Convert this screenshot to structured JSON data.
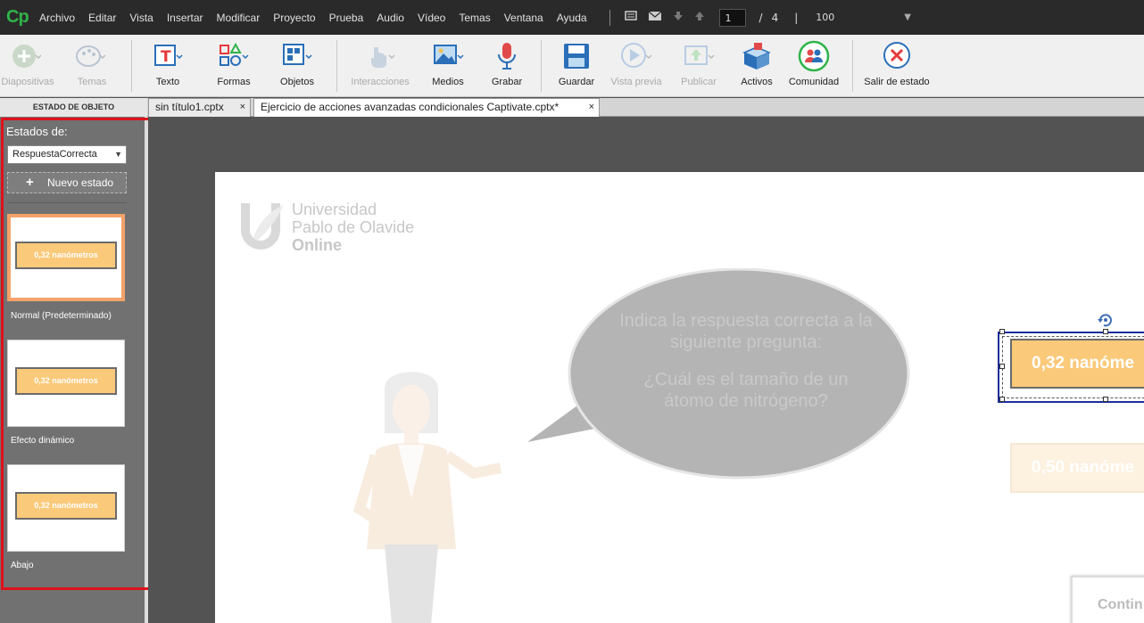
{
  "app": {
    "logo": "Cp"
  },
  "menu": {
    "items": [
      "Archivo",
      "Editar",
      "Vista",
      "Insertar",
      "Modificar",
      "Proyecto",
      "Prueba",
      "Audio",
      "Vídeo",
      "Temas",
      "Ventana",
      "Ayuda"
    ]
  },
  "nav": {
    "current_page": "1",
    "slash": "/",
    "total_pages": "4",
    "separator": "|",
    "zoom": "100"
  },
  "toolbar": {
    "diapositivas": "Diapositivas",
    "temas": "Temas",
    "texto": "Texto",
    "formas": "Formas",
    "objetos": "Objetos",
    "interacciones": "Interacciones",
    "medios": "Medios",
    "grabar": "Grabar",
    "guardar": "Guardar",
    "vista_previa": "Vista previa",
    "publicar": "Publicar",
    "activos": "Activos",
    "comunidad": "Comunidad",
    "salir": "Salir de estado"
  },
  "tabs": {
    "panel_title": "ESTADO DE OBJETO",
    "doc1": "sin título1.cptx",
    "doc2": "Ejercicio de acciones avanzadas condicionales Captivate.cptx*",
    "close": "×"
  },
  "states": {
    "label": "Estados de:",
    "selected": "RespuestaCorrecta",
    "new_state": "Nuevo estado",
    "plus": "+",
    "items": [
      {
        "name": "Normal (Predeterminado)",
        "button_text": "0,32 nanómetros"
      },
      {
        "name": "Efecto dinámico",
        "button_text": "0,32 nanómetros"
      },
      {
        "name": "Abajo",
        "button_text": "0,32 nanómetros"
      }
    ]
  },
  "slide": {
    "logo_line1": "Universidad",
    "logo_line2": "Pablo de Olavide",
    "logo_line3": "Online",
    "bubble_q1": "Indica la respuesta correcta a la siguiente pregunta:",
    "bubble_q2": "¿Cuál es el tamaño de un átomo de nitrógeno?",
    "answer1": "0,32 nanóme",
    "answer2": "0,50 nanóme",
    "continue": "Contin"
  },
  "colors": {
    "accent_green": "#2fb34a",
    "selection_red": "#e0111b",
    "button_fill": "#fbc97a",
    "selected_thumb_border": "#f4a26a"
  }
}
